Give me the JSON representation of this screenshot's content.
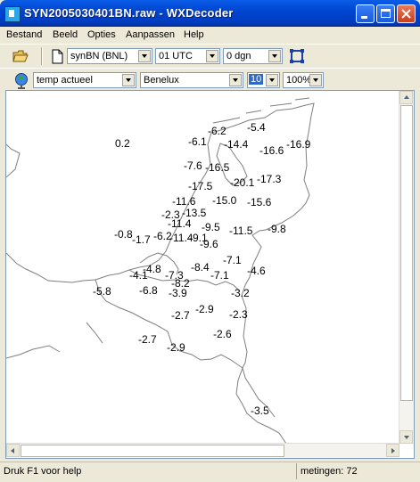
{
  "window": {
    "title": "SYN2005030401BN.raw - WXDecoder",
    "controls": [
      "minimize",
      "maximize",
      "close"
    ]
  },
  "menu": [
    "Bestand",
    "Beeld",
    "Opties",
    "Aanpassen",
    "Help"
  ],
  "toolbar1": {
    "source": "synBN (BNL)",
    "time": "01 UTC",
    "days": "0 dgn"
  },
  "toolbar2": {
    "parameter": "temp actueel",
    "region": "Benelux",
    "font_size": "10",
    "zoom": "100%"
  },
  "map": {
    "observations": [
      "0.2",
      "-6.2",
      "-5.4",
      "-6.1",
      "-14.4",
      "-16.6",
      "-16.9",
      "-7.6",
      "-16.5",
      "-20.1",
      "-17.3",
      "-17.5",
      "-11.6",
      "-15.0",
      "-15.6",
      "-13.5",
      "-2.3",
      "-11.4",
      "-9.5",
      "-0.8",
      "-1.7",
      "-6.2",
      "-11.4",
      "-9.1",
      "-11.5",
      "-9.8",
      "-9.6",
      "-7.1",
      "-4.1",
      "-4.8",
      "-8.4",
      "-4.6",
      "-7.3",
      "-7.1",
      "-5.8",
      "-8.2",
      "-6.8",
      "-3.9",
      "-3.2",
      "-2.9",
      "-2.7",
      "-2.3",
      "-2.6",
      "-2.7",
      "-2.9",
      "-3.5"
    ]
  },
  "status": {
    "help": "Druk F1 voor help",
    "count": "metingen: 72"
  }
}
